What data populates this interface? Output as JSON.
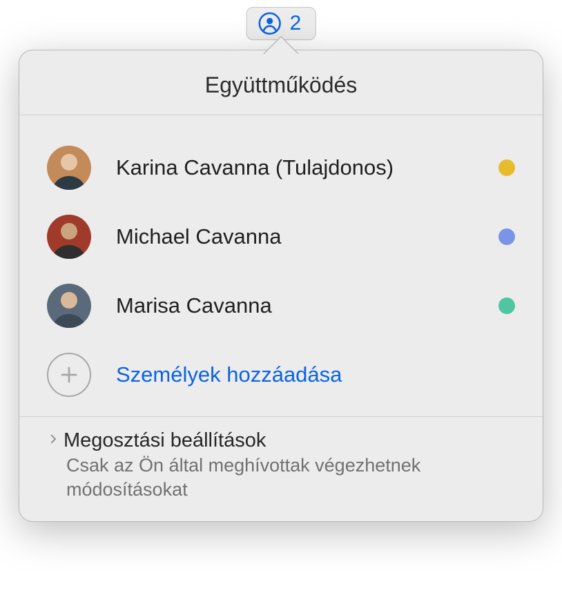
{
  "toolbar": {
    "count": "2",
    "icon": "user-collaboration-icon"
  },
  "popover": {
    "title": "Együttműködés",
    "participants": [
      {
        "name": "Karina Cavanna (Tulajdonos)",
        "statusColor": "#e8bb2c",
        "avatar": {
          "bg": "#c38a5a",
          "shirt": "#2d3a46"
        }
      },
      {
        "name": "Michael Cavanna",
        "statusColor": "#7a94e6",
        "avatar": {
          "bg": "#a03a2a",
          "shirt": "#2f2f2f"
        }
      },
      {
        "name": "Marisa Cavanna",
        "statusColor": "#4fc6a0",
        "avatar": {
          "bg": "#5a6a7a",
          "shirt": "#3c4a58"
        }
      }
    ],
    "addLabel": "Személyek hozzáadása",
    "settings": {
      "title": "Megosztási beállítások",
      "subtitle": "Csak az Ön által meghívottak végezhetnek módosításokat"
    }
  }
}
